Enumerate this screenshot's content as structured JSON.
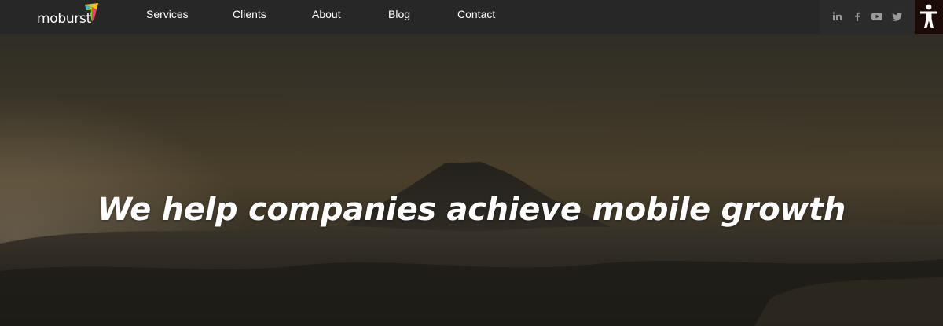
{
  "brand": {
    "logo_text": "moburst",
    "logo_mark_colors": [
      "#f7c600",
      "#2fb7e8",
      "#ef3f6b",
      "#8cc63f"
    ]
  },
  "nav": {
    "items": [
      {
        "label": "Services"
      },
      {
        "label": "Clients"
      },
      {
        "label": "About"
      },
      {
        "label": "Blog"
      },
      {
        "label": "Contact"
      }
    ]
  },
  "social": {
    "icons": [
      "linkedin-icon",
      "facebook-icon",
      "youtube-icon",
      "twitter-icon"
    ]
  },
  "accessibility": {
    "icon": "accessibility-icon"
  },
  "hero": {
    "headline": "We help companies achieve mobile growth"
  },
  "colors": {
    "navbar_bg": "#282828",
    "text": "#ffffff",
    "social_icon": "#9a9a9a"
  }
}
